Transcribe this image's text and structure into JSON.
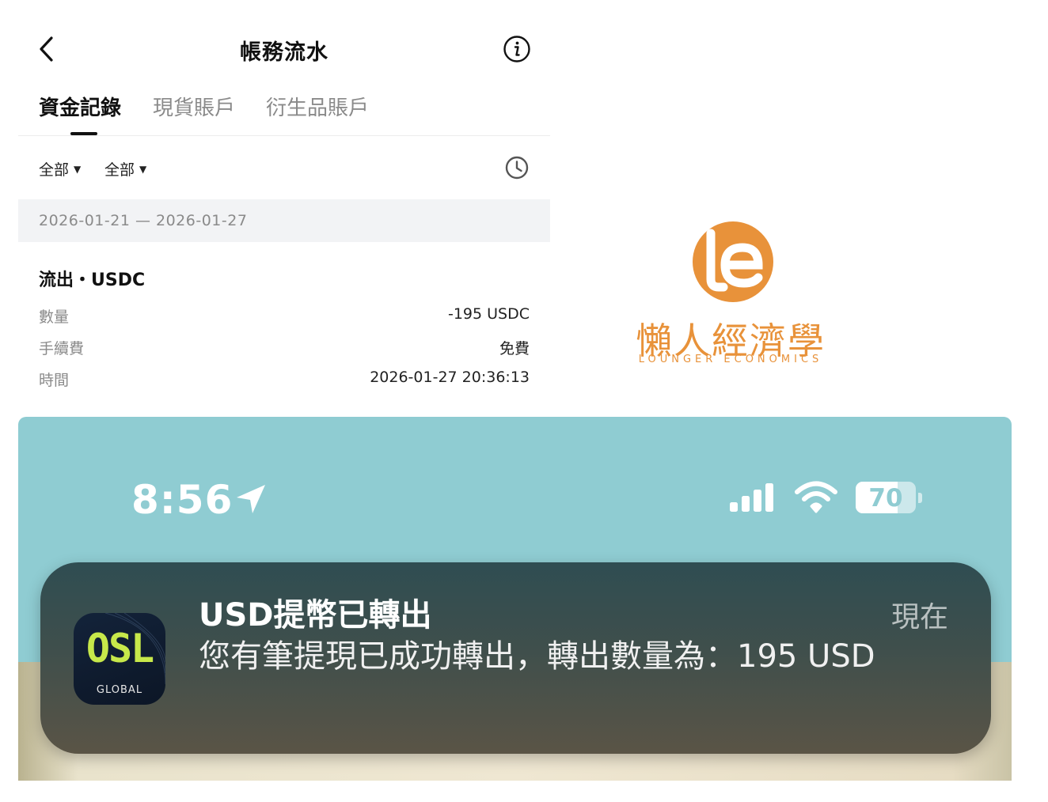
{
  "app": {
    "title": "帳務流水",
    "tabs": [
      {
        "label": "資金記錄",
        "active": true
      },
      {
        "label": "現貨賬戶",
        "active": false
      },
      {
        "label": "衍生品賬戶",
        "active": false
      }
    ],
    "filters": [
      {
        "label": "全部"
      },
      {
        "label": "全部"
      }
    ],
    "date_range": "2026-01-21 — 2026-01-27",
    "record": {
      "title": "流出・USDC",
      "rows": [
        {
          "label": "數量",
          "value": "-195 USDC"
        },
        {
          "label": "手續費",
          "value": "免費"
        },
        {
          "label": "時間",
          "value": "2026-01-27 20:36:13"
        }
      ]
    },
    "icons": [
      "chevron-left-icon",
      "info-icon",
      "clock-icon",
      "caret-down-icon"
    ]
  },
  "logo": {
    "mark": "le",
    "chinese": "懶人經濟學",
    "english": "LOUNGER ECONOMICS",
    "color": "#e8923a"
  },
  "phone": {
    "status": {
      "time": "8:56",
      "battery_percent": "70",
      "battery_level": 0.7
    },
    "notification": {
      "app_icon_text": "OSL",
      "app_icon_subtext": "GLOBAL",
      "title": "USD提幣已轉出",
      "time": "現在",
      "body": "您有筆提現已成功轉出，轉出數量為：195 USD"
    },
    "colors": {
      "status_bg": "#8fccd2",
      "notif_bg": "#3f4f4c",
      "osl_accent": "#c7e84a"
    }
  }
}
